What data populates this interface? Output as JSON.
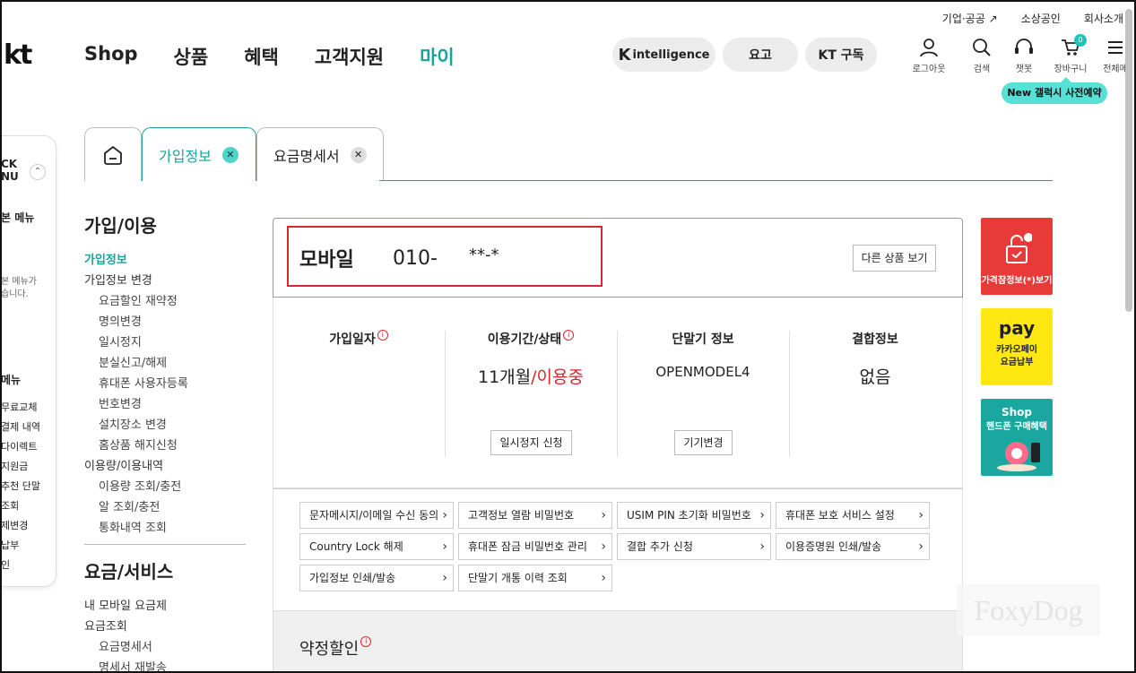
{
  "util_links": [
    "기업·공공 ↗",
    "소상공인",
    "회사소개"
  ],
  "logo": "kt",
  "gnb": [
    "Shop",
    "상품",
    "혜택",
    "고객지원",
    "마이"
  ],
  "pills": {
    "k_mark": "K",
    "k_text": "intelligence",
    "fee": "요고",
    "subscribe": "KT 구독"
  },
  "header_icons": {
    "login": "로그아웃",
    "search": "검색",
    "chat": "챗봇",
    "cart": "장바구니",
    "cart_count": "0",
    "menu": "전체메"
  },
  "galaxy_badge": "New 갤럭시 사전예약",
  "quick_menu": {
    "title": "CK\nNU",
    "up_icon": "⌃",
    "sub1": "본 메뉴",
    "desc": "본 메뉴가\n습니다.",
    "sub2": "메뉴",
    "items": [
      "무료교체",
      "결제 내역",
      "다이렉트",
      "지원금",
      "추천 단말",
      "조회",
      "제변경",
      "납부",
      "인"
    ]
  },
  "tabs": {
    "home_icon": "home-icon",
    "tab1": "가입정보",
    "tab2": "요금명세서",
    "close": "✕"
  },
  "left_nav": {
    "section1": "가입/이용",
    "items1": [
      {
        "label": "가입정보",
        "level": 0,
        "active": true
      },
      {
        "label": "가입정보 변경",
        "level": 0
      },
      {
        "label": "요금할인 재약정",
        "level": 1
      },
      {
        "label": "명의변경",
        "level": 1
      },
      {
        "label": "일시정지",
        "level": 1
      },
      {
        "label": "분실신고/해제",
        "level": 1
      },
      {
        "label": "휴대폰 사용자등록",
        "level": 1
      },
      {
        "label": "번호변경",
        "level": 1
      },
      {
        "label": "설치장소 변경",
        "level": 1
      },
      {
        "label": "홈상품 해지신청",
        "level": 1
      },
      {
        "label": "이용량/이용내역",
        "level": 0
      },
      {
        "label": "이용량 조회/충전",
        "level": 1
      },
      {
        "label": "알 조회/충전",
        "level": 1
      },
      {
        "label": "통화내역 조회",
        "level": 1
      }
    ],
    "section2": "요금/서비스",
    "items2": [
      {
        "label": "내 모바일 요금제",
        "level": 0
      },
      {
        "label": "요금조회",
        "level": 0
      },
      {
        "label": "요금명세서",
        "level": 1
      },
      {
        "label": "명세서 재발송",
        "level": 1
      }
    ]
  },
  "product": {
    "title": "모바일",
    "number": "010-",
    "masked": "**-*",
    "other_btn": "다른 상품 보기"
  },
  "info": {
    "join_date": {
      "label": "가입일자",
      "value": ""
    },
    "period": {
      "label": "이용기간/상태",
      "months": "11개월",
      "sep": "/",
      "status": "이용중",
      "button": "일시정지 신청"
    },
    "device": {
      "label": "단말기 정보",
      "value": "OPENMODEL4",
      "button": "기기변경"
    },
    "bundle": {
      "label": "결합정보",
      "value": "없음"
    },
    "info_glyph": "i"
  },
  "links": [
    "문자메시지/이메일 수신 동의",
    "고객정보 열람 비밀번호",
    "USIM PIN 초기화 비밀번호",
    "휴대폰 보호 서비스 설정",
    "Country Lock 해제",
    "휴대폰 잠금 비밀번호 관리",
    "결합 추가 신청",
    "이용증명원 인쇄/발송",
    "가입정보 인쇄/발송",
    "단말기 개통 이력 조회"
  ],
  "discount": {
    "title": "약정할인"
  },
  "banners": {
    "b1": "가격잠정보(*)보기",
    "b2_logo": "pay",
    "b2_text": "카카오페이\n요금납부",
    "b3_top": "Shop",
    "b3_text": "핸드폰 구매혜택"
  },
  "watermark": "FoxyDog",
  "colors": {
    "accent": "#1aa39a",
    "red": "#d6282d",
    "mint": "#56e1d6"
  }
}
